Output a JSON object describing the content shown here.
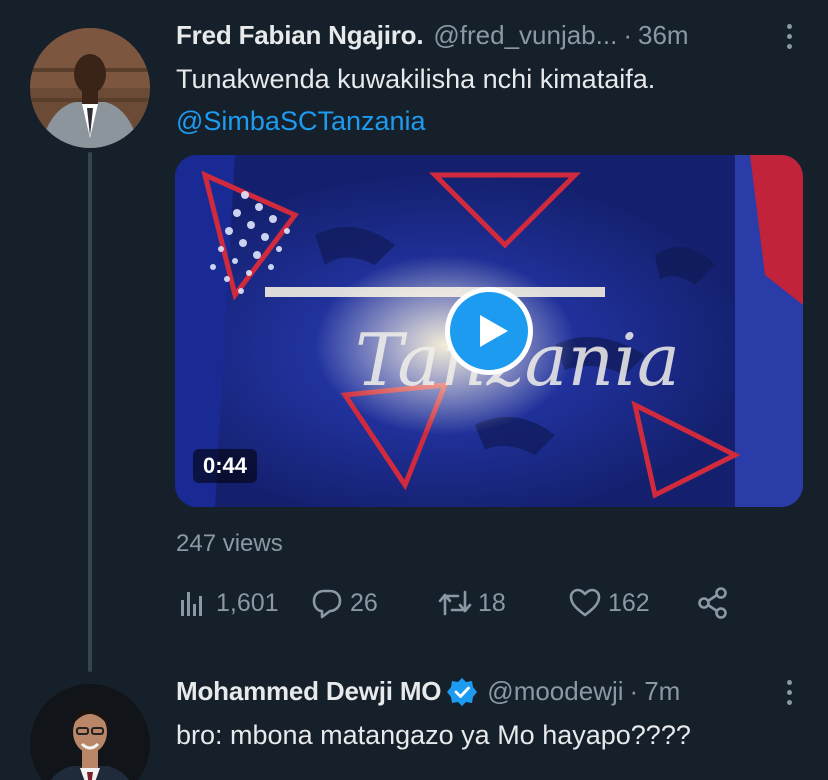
{
  "tweets": [
    {
      "name": "Fred Fabian Ngajiro.",
      "handle": "@fred_vunjab...",
      "separator": "·",
      "time": "36m",
      "text": "Tunakwenda kuwakilisha nchi kimataifa.",
      "mention": "@SimbaSCTanzania",
      "video": {
        "duration": "0:44",
        "overlay_text": "Tanzania"
      },
      "views": "247 views",
      "stats": {
        "analytics": "1,601",
        "replies": "26",
        "retweets": "18",
        "likes": "162"
      },
      "icons": [
        "analytics-icon",
        "reply-icon",
        "retweet-icon",
        "like-icon",
        "share-icon",
        "more-icon",
        "play-icon"
      ]
    },
    {
      "name": "Mohammed Dewji MO",
      "handle": "@moodewji",
      "separator": "·",
      "time": "7m",
      "text": "bro: mbona matangazo ya Mo hayapo????",
      "verified": true,
      "icons": [
        "verified-badge-icon",
        "more-icon"
      ]
    }
  ],
  "colors": {
    "background": "#15202b",
    "accent": "#1d9bf0",
    "muted": "#8b98a5",
    "thread_line": "#38444d"
  }
}
